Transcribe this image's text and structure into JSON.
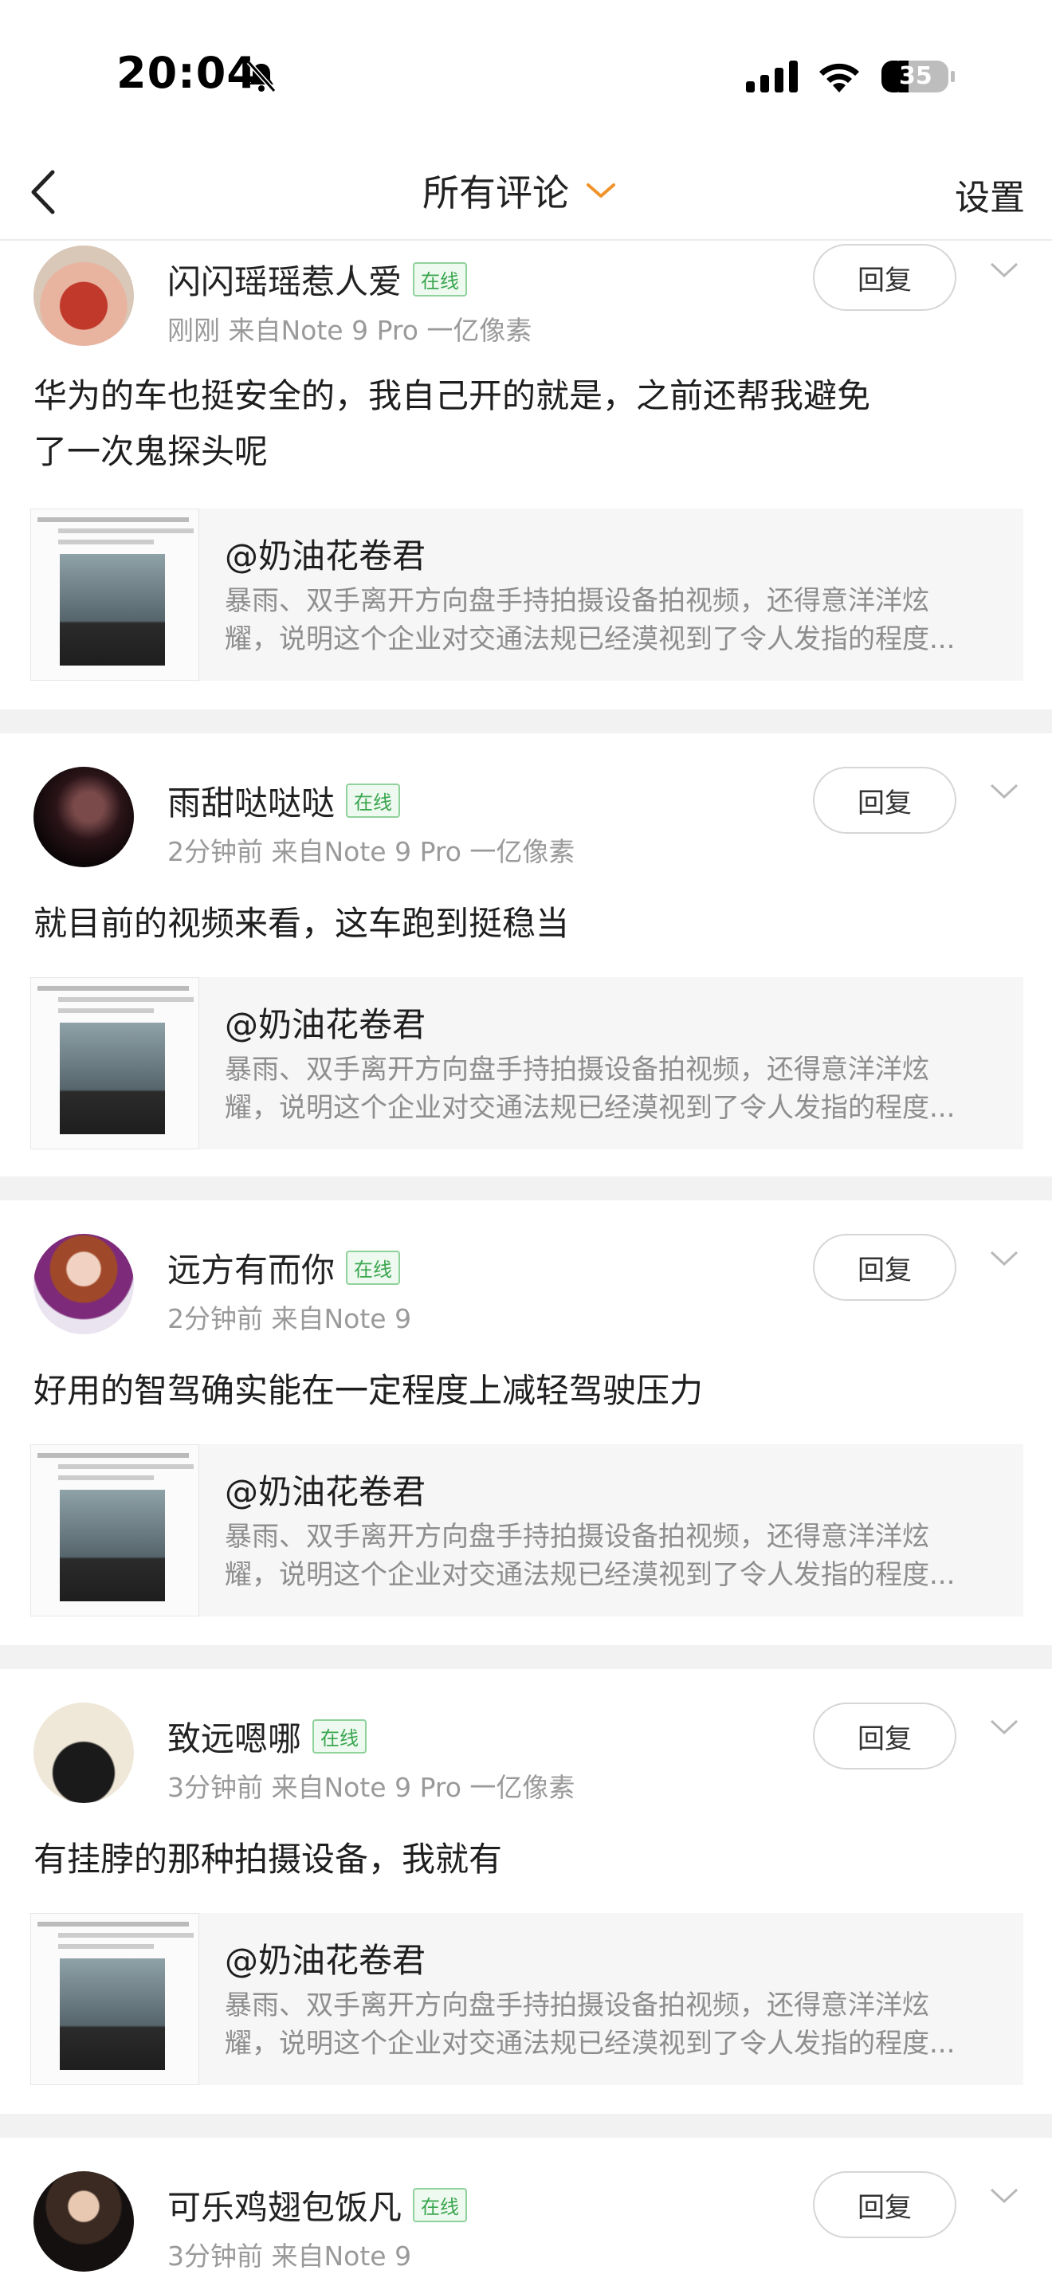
{
  "status_bar": {
    "time": "20:04",
    "battery": "35"
  },
  "header": {
    "title": "所有评论",
    "settings_label": "设置"
  },
  "quoted_post": {
    "author": "@奶油花卷君",
    "excerpt_line1": "暴雨、双手离开方向盘手持拍摄设备拍视频，还得意洋洋炫",
    "excerpt_line2": "耀，说明这个企业对交通法规已经漠视到了令人发指的程度..."
  },
  "reply_label": "回复",
  "online_label": "在线",
  "comments": [
    {
      "name": "闪闪瑶瑶惹人爱",
      "meta": "刚刚   来自Note 9 Pro 一亿像素",
      "text_line1": "华为的车也挺安全的，我自己开的就是，之前还帮我避免",
      "text_line2": "了一次鬼探头呢"
    },
    {
      "name": "雨甜哒哒哒",
      "meta": "2分钟前   来自Note 9 Pro 一亿像素",
      "text_line1": "就目前的视频来看，这车跑到挺稳当"
    },
    {
      "name": "远方有而你",
      "meta": "2分钟前   来自Note 9",
      "text_line1": "好用的智驾确实能在一定程度上减轻驾驶压力"
    },
    {
      "name": "致远嗯哪",
      "meta": "3分钟前   来自Note 9 Pro 一亿像素",
      "text_line1": "有挂脖的那种拍摄设备，我就有"
    },
    {
      "name": "可乐鸡翅包饭凡",
      "meta": "3分钟前   来自Note 9"
    }
  ],
  "colors": {
    "online_green": "#3aa64e",
    "accent_orange": "#f0932b",
    "divider_gray": "#f2f2f2"
  }
}
